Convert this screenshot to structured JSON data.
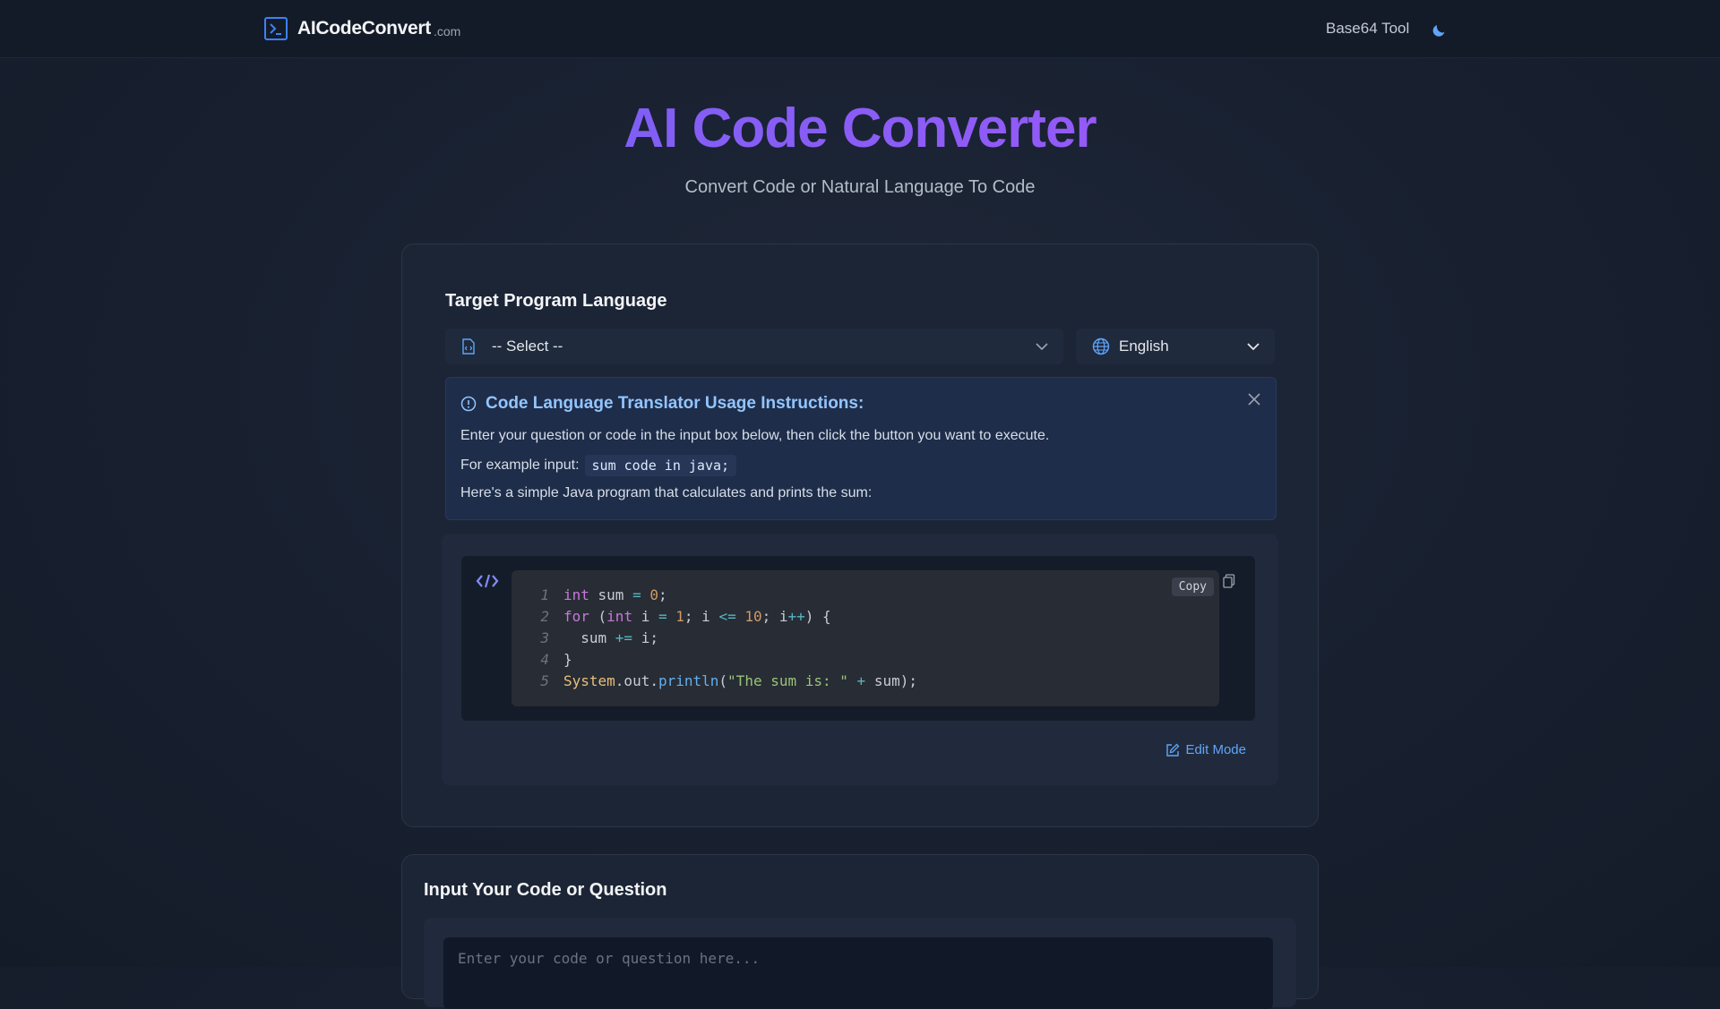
{
  "header": {
    "brand_name": "AICodeConvert",
    "brand_tld": ".com",
    "nav_link": "Base64 Tool"
  },
  "hero": {
    "title": "AI Code Converter",
    "subtitle": "Convert Code or Natural Language To Code"
  },
  "target_card": {
    "title": "Target Program Language",
    "language_select_value": "-- Select --",
    "locale_select_value": "English"
  },
  "instructions": {
    "title": "Code Language Translator Usage Instructions:",
    "line1": "Enter your question or code in the input box below, then click the button you want to execute.",
    "line2_prefix": "For example input:",
    "line2_code": "sum code in java;",
    "line3": "Here's a simple Java program that calculates and prints the sum:"
  },
  "example": {
    "copy_label": "Copy",
    "edit_mode_label": "Edit Mode",
    "code_lines": [
      "int sum = 0;",
      "for (int i = 1; i <= 10; i++) {",
      "  sum += i;",
      "}",
      "System.out.println(\"The sum is: \" + sum);"
    ]
  },
  "input_card": {
    "title": "Input Your Code or Question",
    "placeholder": "Enter your code or question here..."
  },
  "colors": {
    "accent_blue": "#3b82f6",
    "title_gradient_start": "#6366f1",
    "title_gradient_end": "#a855f7",
    "info_title": "#93c5fd",
    "link_blue": "#60a5fa"
  },
  "icons": {
    "brand": "terminal-icon",
    "theme": "moon-icon",
    "file": "file-code-icon",
    "globe": "globe-icon",
    "info": "info-circle-icon",
    "close": "close-icon",
    "code": "code-tag-icon",
    "clipboard": "clipboard-icon",
    "edit": "edit-icon"
  }
}
